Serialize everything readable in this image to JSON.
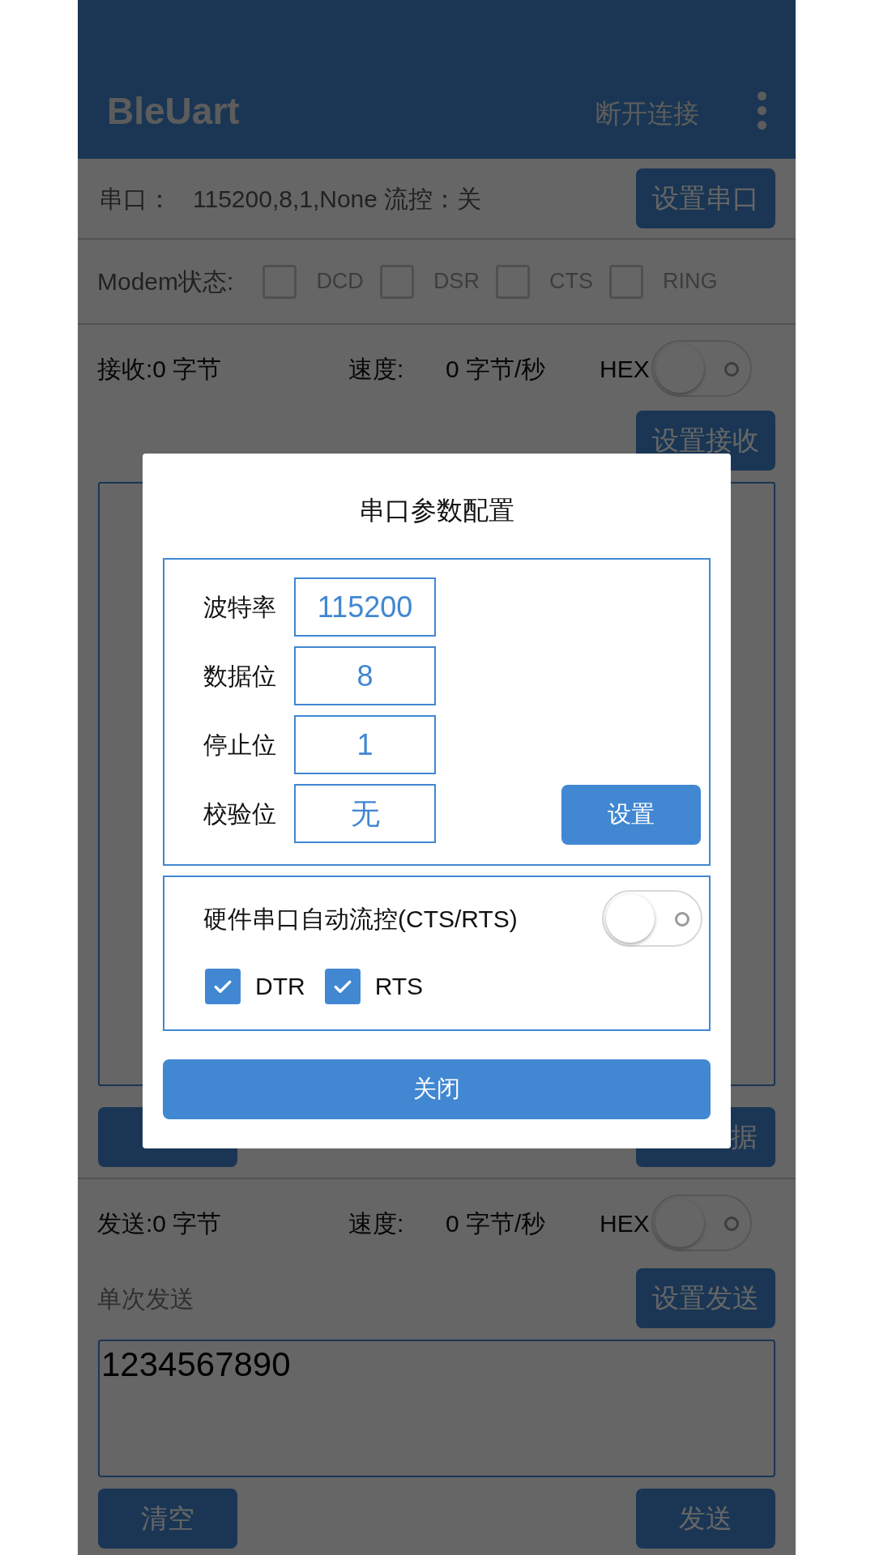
{
  "app_bar": {
    "title": "BleUart",
    "action": "断开连接"
  },
  "serial_row": {
    "label": "串口：",
    "value": "115200,8,1,None 流控：关",
    "button": "设置串口"
  },
  "modem": {
    "label": "Modem状态:",
    "signals": [
      {
        "label": "DCD",
        "checked": false
      },
      {
        "label": "DSR",
        "checked": false
      },
      {
        "label": "CTS",
        "checked": false
      },
      {
        "label": "RING",
        "checked": false
      }
    ]
  },
  "receive": {
    "count": "接收:0 字节",
    "speed_label": "速度:",
    "speed": "0 字节/秒",
    "hex_label": "HEX",
    "hex_on": false,
    "button": "设置接收",
    "right_button": "据"
  },
  "send": {
    "count": "发送:0 字节",
    "speed_label": "速度:",
    "speed": "0 字节/秒",
    "hex_label": "HEX",
    "hex_on": false,
    "mode": "单次发送",
    "button": "设置发送",
    "value": "1234567890",
    "clear_button": "清空",
    "send_button": "发送"
  },
  "dialog": {
    "title": "串口参数配置",
    "params": [
      {
        "label": "波特率",
        "value": "115200"
      },
      {
        "label": "数据位",
        "value": "8"
      },
      {
        "label": "停止位",
        "value": "1"
      },
      {
        "label": "校验位",
        "value": "无"
      }
    ],
    "set_button": "设置",
    "flow_control": {
      "label": "硬件串口自动流控(CTS/RTS)",
      "on": false
    },
    "lines": [
      {
        "label": "DTR",
        "checked": true
      },
      {
        "label": "RTS",
        "checked": true
      }
    ],
    "close_button": "关闭"
  }
}
